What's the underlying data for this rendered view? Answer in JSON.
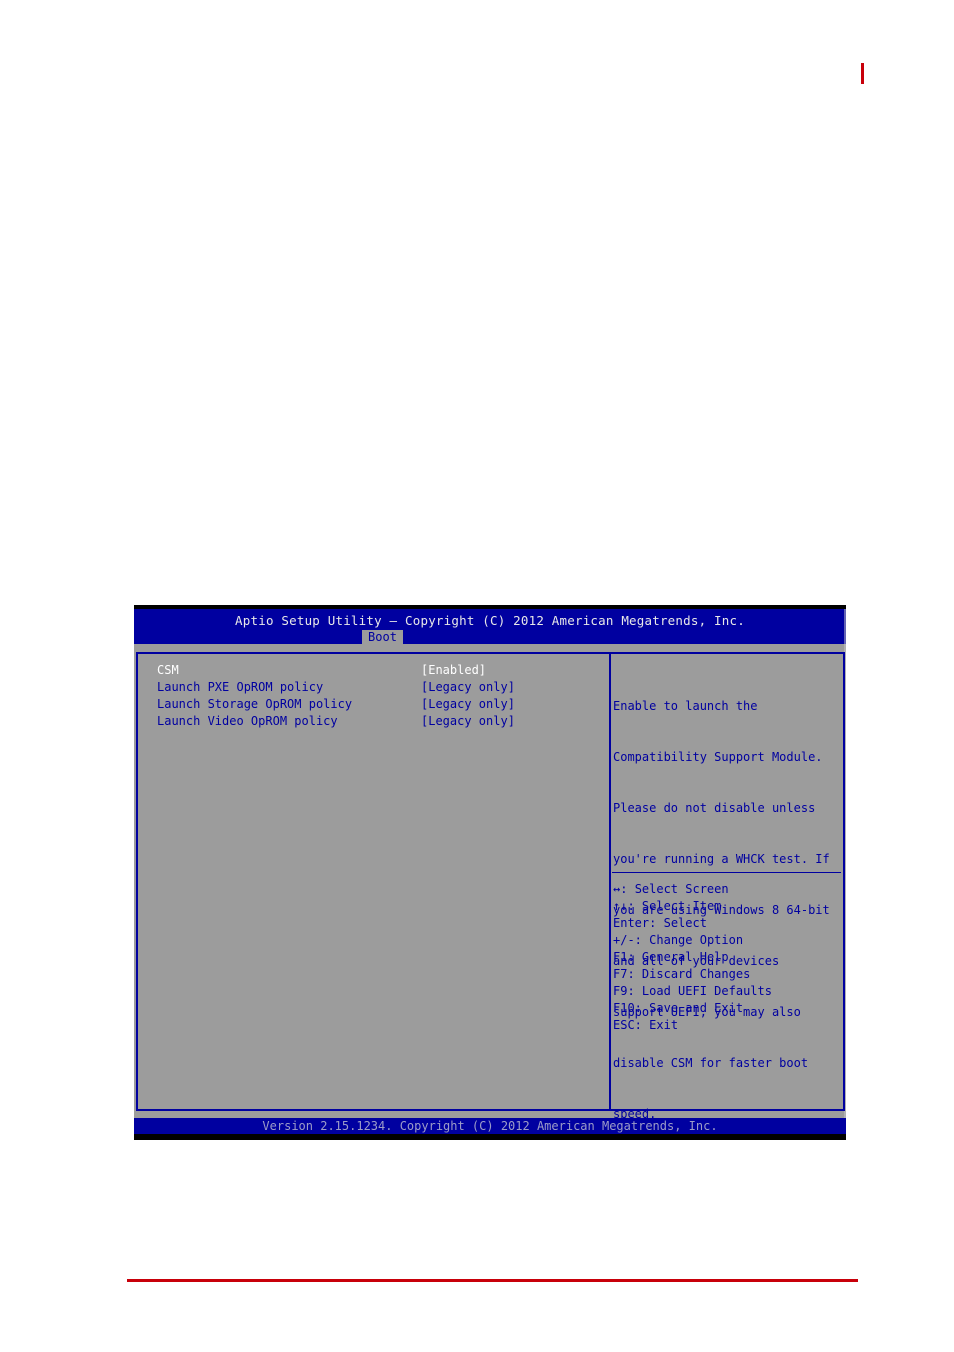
{
  "page": {
    "accent_color": "#c8000a"
  },
  "bios": {
    "title": "Aptio Setup Utility – Copyright (C) 2012 American Megatrends, Inc.",
    "active_tab": "Boot",
    "colors": {
      "header_bg": "#0000a0",
      "body_bg": "#9c9c9c",
      "text": "#0000a0",
      "selected_text": "#ffffff"
    },
    "settings": [
      {
        "label": "CSM",
        "value": "[Enabled]",
        "selected": true
      },
      {
        "label": "Launch PXE OpROM policy",
        "value": "[Legacy only]",
        "selected": false
      },
      {
        "label": "Launch Storage OpROM policy",
        "value": "[Legacy only]",
        "selected": false
      },
      {
        "label": "Launch Video OpROM policy",
        "value": "[Legacy only]",
        "selected": false
      }
    ],
    "help_lines": [
      "Enable to launch the",
      "Compatibility Support Module.",
      "Please do not disable unless",
      "you're running a WHCK test. If",
      "you are using Windows 8 64-bit",
      "and all of your devices",
      "support UEFI, you may also",
      "disable CSM for faster boot",
      "speed."
    ],
    "key_legend": [
      {
        "key": "↔:",
        "action": "Select Screen"
      },
      {
        "key": "↑↓:",
        "action": "Select Item"
      },
      {
        "key": "Enter:",
        "action": "Select"
      },
      {
        "key": "+/-:",
        "action": "Change Option"
      },
      {
        "key": "F1:",
        "action": "General Help"
      },
      {
        "key": "F7:",
        "action": "Discard Changes"
      },
      {
        "key": "F9:",
        "action": "Load UEFI Defaults"
      },
      {
        "key": "F10:",
        "action": "Save and Exit"
      },
      {
        "key": "ESC:",
        "action": "Exit"
      }
    ],
    "footer": "Version 2.15.1234. Copyright (C) 2012 American Megatrends, Inc."
  }
}
